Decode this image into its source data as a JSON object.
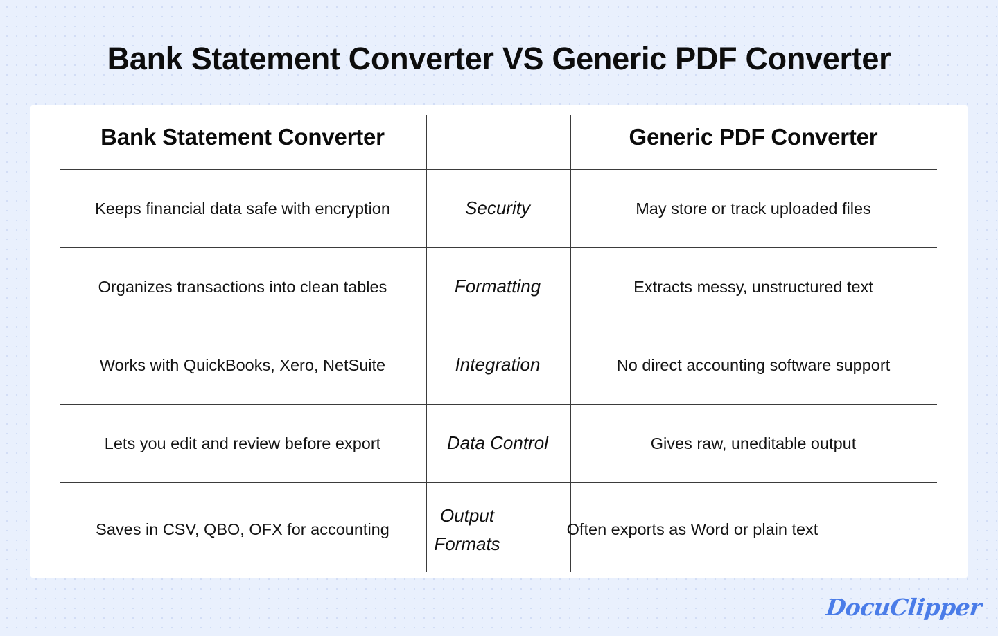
{
  "page": {
    "title": "Bank Statement Converter VS Generic PDF Converter",
    "background_color": "#e9f0fd",
    "card_color": "#ffffff",
    "text_color": "#131313",
    "rule_color": "#3b3b3b"
  },
  "table": {
    "headers": {
      "left": "Bank Statement Converter",
      "middle": "",
      "right": "Generic PDF Converter"
    },
    "rows": [
      {
        "left": "Keeps financial data safe with encryption",
        "middle": "Security",
        "right": "May store or track uploaded files"
      },
      {
        "left": "Organizes transactions into clean tables",
        "middle": "Formatting",
        "right": "Extracts messy, unstructured text"
      },
      {
        "left": "Works with QuickBooks, Xero, NetSuite",
        "middle": "Integration",
        "right": "No direct accounting software support"
      },
      {
        "left": "Lets you edit and review before export",
        "middle": "Data Control",
        "right": "Gives raw, uneditable output"
      },
      {
        "left": "Saves in CSV, QBO, OFX for accounting",
        "middle": "Output Formats",
        "right": "Often exports as Word or plain text"
      }
    ]
  },
  "logo": {
    "text": "DocuClipper",
    "color": "#4a7ce8"
  }
}
